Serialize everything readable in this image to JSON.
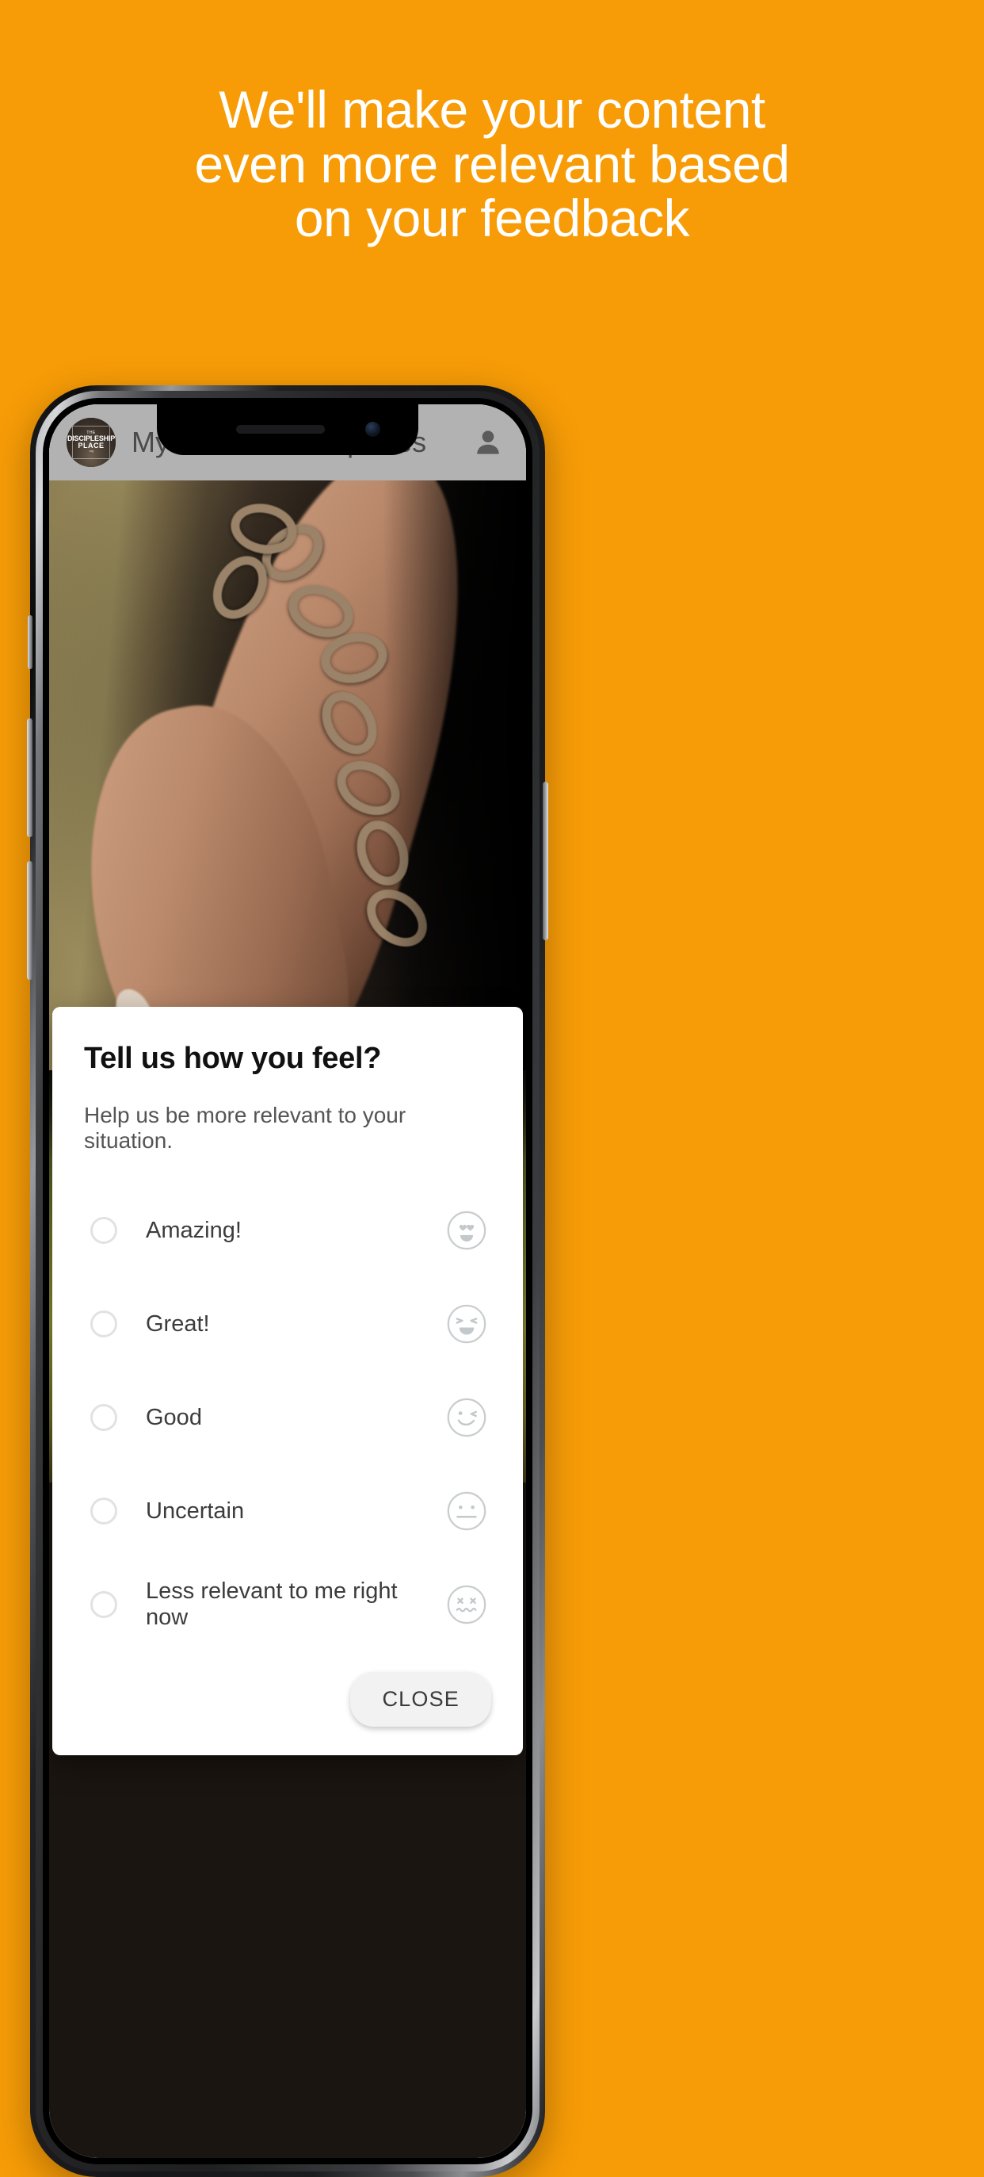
{
  "promo": {
    "background_color": "#F79C07",
    "headline_lines": [
      "We'll make your content",
      "even more relevant based",
      "on your feedback"
    ]
  },
  "phone": {
    "buttons": {
      "silent_switch": "silent-switch",
      "volume_up": "volume-up",
      "volume_down": "volume-down",
      "power": "power"
    }
  },
  "app": {
    "appbar": {
      "brand_logo": {
        "line_the": "THE",
        "line_discipleship": "DISCIPLESHIP",
        "line_place": "PLACE",
        "line_sub": ".org"
      },
      "title": "My Personal Scriptures",
      "account_icon": "person-icon"
    },
    "feed": [
      {
        "name": "chained-hands-photo"
      },
      {
        "name": "person-in-field-photo"
      }
    ]
  },
  "dialog": {
    "title": "Tell us how you feel?",
    "subtitle": "Help us be more relevant to your situation.",
    "options": [
      {
        "label": "Amazing!",
        "emoji": "heart-eyes-face-icon",
        "selected": false
      },
      {
        "label": "Great!",
        "emoji": "laughing-face-icon",
        "selected": false
      },
      {
        "label": "Good",
        "emoji": "winking-face-icon",
        "selected": false
      },
      {
        "label": "Uncertain",
        "emoji": "neutral-face-icon",
        "selected": false
      },
      {
        "label": "Less relevant to me right now",
        "emoji": "dizzy-face-icon",
        "selected": false
      }
    ],
    "close_label": "CLOSE"
  }
}
